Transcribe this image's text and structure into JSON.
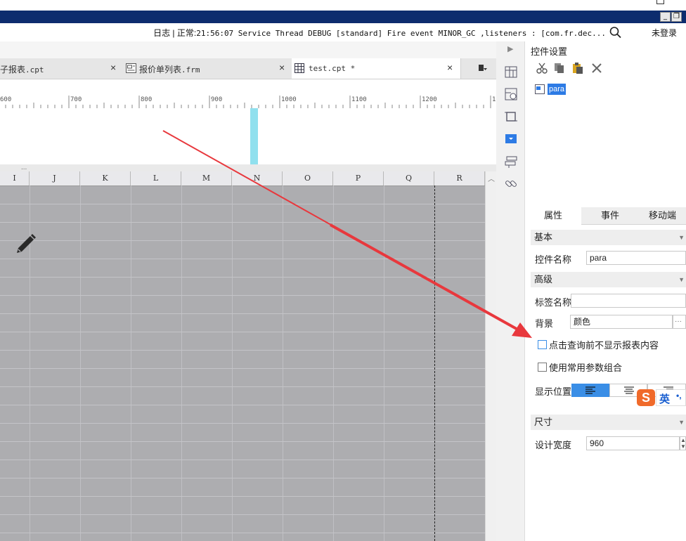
{
  "window": {
    "minimize_glyph": "_",
    "restore_glyph": "❐"
  },
  "status": {
    "log_prefix": "日志 | 正常:",
    "log_text": "21:56:07 Service Thread DEBUG [standard] Fire event MINOR_GC ,listeners : [com.fr.dec...",
    "login": "未登录"
  },
  "tabs": [
    {
      "label_cn": "子报表",
      "label_ext": ".cpt",
      "close": "×"
    },
    {
      "label_cn": "报价单列表",
      "label_ext": ".frm",
      "close": "×"
    },
    {
      "label_cn": "",
      "label_ext": "test.cpt *",
      "close": "×"
    }
  ],
  "ruler": {
    "labels": [
      "600",
      "700",
      "800",
      "900",
      "1000",
      "1100",
      "1200",
      "1"
    ]
  },
  "splitter_dots": "...",
  "grid": {
    "columns": [
      "I",
      "J",
      "K",
      "L",
      "M",
      "N",
      "O",
      "P",
      "Q",
      "R"
    ]
  },
  "panel": {
    "title": "控件设置",
    "tree_item": "para",
    "prop_tabs": [
      "属性",
      "事件",
      "移动端"
    ],
    "section_basic": "基本",
    "widget_name_label": "控件名称",
    "widget_name_value": "para",
    "section_advanced": "高级",
    "tag_name_label": "标签名称",
    "tag_name_value": "",
    "background_label": "背景",
    "background_value": "颜色",
    "background_more": "···",
    "checkbox_hide_before_query": "点击查询前不显示报表内容",
    "checkbox_common_params": "使用常用参数组合",
    "position_label": "显示位置",
    "section_size": "尺寸",
    "design_width_label": "设计宽度",
    "design_width_value": "960"
  },
  "ime": {
    "mode": "英",
    "punct": "•,"
  },
  "colors": {
    "titlebar": "#0d2c6e",
    "grid": "#adadb0",
    "param_marker": "#90e0ee",
    "selection": "#2d7be5",
    "arrow": "#e8383d"
  }
}
